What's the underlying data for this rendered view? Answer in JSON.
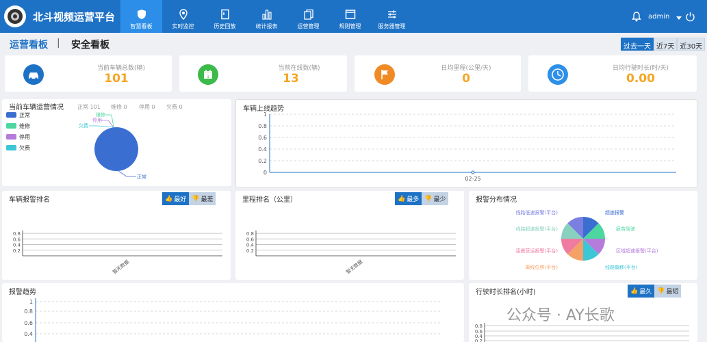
{
  "app": {
    "title": "北斗视频运营平台"
  },
  "nav": [
    {
      "label": "智慧看板",
      "icon": "shield-icon",
      "active": true
    },
    {
      "label": "实时监控",
      "icon": "map-pin-icon"
    },
    {
      "label": "历史回放",
      "icon": "document-icon"
    },
    {
      "label": "统计报表",
      "icon": "bar-chart-icon"
    },
    {
      "label": "运营管理",
      "icon": "copy-icon"
    },
    {
      "label": "规则管理",
      "icon": "window-icon"
    },
    {
      "label": "服务器管理",
      "icon": "sliders-icon"
    }
  ],
  "user": {
    "name": "admin"
  },
  "tabs": {
    "ops": "运营看板",
    "sep": "|",
    "safety": "安全看板"
  },
  "range": [
    "过去一天",
    "近7天",
    "近30天"
  ],
  "stats": [
    {
      "label": "当前车辆总数(辆)",
      "value": "101",
      "icon": "car-icon",
      "color": "#1e72c6"
    },
    {
      "label": "当前在线数(辆)",
      "value": "13",
      "icon": "calendar-icon",
      "color": "#3cba4a"
    },
    {
      "label": "日均里程(公里/天)",
      "value": "0",
      "icon": "flag-icon",
      "color": "#f08a24"
    },
    {
      "label": "日均行驶时长(时/天)",
      "value": "0.00",
      "icon": "clock-icon",
      "color": "#2d8fe8"
    }
  ],
  "vehicle_ops": {
    "title": "当前车辆运营情况",
    "summary": [
      "正常 101",
      "维修 0",
      "停用 0",
      "欠费 0"
    ],
    "legend": [
      {
        "name": "正常",
        "color": "#3a6fd1"
      },
      {
        "name": "维修",
        "color": "#4cd6a0"
      },
      {
        "name": "停用",
        "color": "#b57cdc"
      },
      {
        "name": "欠费",
        "color": "#3dc6d6"
      }
    ],
    "labels": [
      "维修",
      "停用",
      "欠费",
      "正常"
    ]
  },
  "trend_online": {
    "title": "车辆上线趋势",
    "xlabel": "02-25"
  },
  "alarm_rank": {
    "title": "车辆报警排名",
    "best": "最好",
    "worst": "最差",
    "empty": "暂无数据"
  },
  "mileage_rank": {
    "title": "里程排名（公里）",
    "most": "最多",
    "least": "最少",
    "empty": "暂无数据"
  },
  "alarm_dist": {
    "title": "报警分布情况",
    "labels_left": [
      "线路低速报警(平台)",
      "线路超速报警(平台)",
      "凌晨营运报警(平台)",
      "离线位移(平台)"
    ],
    "labels_right": [
      "超速报警",
      "疲劳驾驶",
      "区域超速报警(平台)",
      "线路偏移(平台)"
    ]
  },
  "alarm_trend": {
    "title": "报警趋势"
  },
  "drive_rank": {
    "title": "行驶时长排名(小时)",
    "longest": "最久",
    "shortest": "最短"
  },
  "watermark": "公众号 · AY长歌",
  "chart_data": [
    {
      "type": "pie",
      "title": "当前车辆运营情况",
      "categories": [
        "正常",
        "维修",
        "停用",
        "欠费"
      ],
      "values": [
        101,
        0,
        0,
        0
      ]
    },
    {
      "type": "line",
      "title": "车辆上线趋势",
      "x": [
        "02-25"
      ],
      "values": [
        0
      ],
      "ylim": [
        0,
        1
      ],
      "yticks": [
        0,
        0.2,
        0.4,
        0.6,
        0.8,
        1
      ]
    },
    {
      "type": "bar",
      "title": "车辆报警排名",
      "categories": [],
      "values": [],
      "yticks": [
        0.2,
        0.4,
        0.6,
        0.8
      ]
    },
    {
      "type": "bar",
      "title": "里程排名（公里）",
      "categories": [],
      "values": [],
      "yticks": [
        0.2,
        0.4,
        0.6,
        0.8
      ]
    },
    {
      "type": "pie",
      "title": "报警分布情况",
      "categories": [
        "超速报警",
        "疲劳驾驶",
        "区域超速报警(平台)",
        "线路偏移(平台)",
        "离线位移(平台)",
        "凌晨营运报警(平台)",
        "线路超速报警(平台)",
        "线路低速报警(平台)"
      ],
      "values": [
        1,
        1,
        1,
        1,
        1,
        1,
        1,
        1
      ]
    },
    {
      "type": "line",
      "title": "报警趋势",
      "yticks": [
        0.4,
        0.6,
        0.8,
        1
      ]
    },
    {
      "type": "bar",
      "title": "行驶时长排名(小时)",
      "yticks": [
        0.2,
        0.4,
        0.6,
        0.8
      ]
    }
  ]
}
